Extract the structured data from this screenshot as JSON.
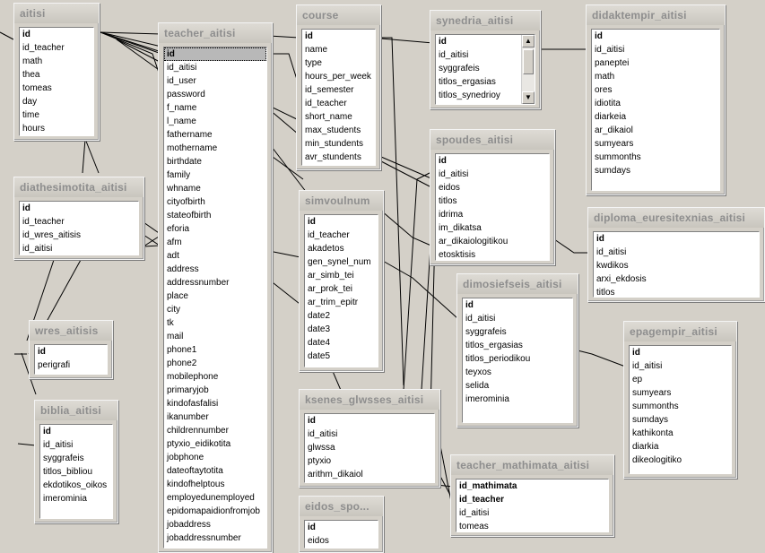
{
  "tables": [
    {
      "name": "aitisi",
      "fields": [
        {
          "label": "id",
          "pk": true
        },
        {
          "label": "id_teacher"
        },
        {
          "label": "math"
        },
        {
          "label": "thea"
        },
        {
          "label": "tomeas"
        },
        {
          "label": "day"
        },
        {
          "label": "time"
        },
        {
          "label": "hours"
        }
      ]
    },
    {
      "name": "teacher_aitisi",
      "fields": [
        {
          "label": "id",
          "pk": true,
          "selected": true
        },
        {
          "label": "id_aitisi"
        },
        {
          "label": "id_user"
        },
        {
          "label": "password"
        },
        {
          "label": "f_name"
        },
        {
          "label": "l_name"
        },
        {
          "label": "fathername"
        },
        {
          "label": "mothername"
        },
        {
          "label": "birthdate"
        },
        {
          "label": "family"
        },
        {
          "label": "whname"
        },
        {
          "label": "cityofbirth"
        },
        {
          "label": "stateofbirth"
        },
        {
          "label": "eforia"
        },
        {
          "label": "afm"
        },
        {
          "label": "adt"
        },
        {
          "label": "address"
        },
        {
          "label": "addressnumber"
        },
        {
          "label": "place"
        },
        {
          "label": "city"
        },
        {
          "label": "tk"
        },
        {
          "label": "mail"
        },
        {
          "label": "phone1"
        },
        {
          "label": "phone2"
        },
        {
          "label": "mobilephone"
        },
        {
          "label": "primaryjob"
        },
        {
          "label": "kindofasfalisi"
        },
        {
          "label": "ikanumber"
        },
        {
          "label": "childrennumber"
        },
        {
          "label": "ptyxio_eidikotita"
        },
        {
          "label": "jobphone"
        },
        {
          "label": "dateoftaytotita"
        },
        {
          "label": "kindofhelptous"
        },
        {
          "label": "employedunemployed"
        },
        {
          "label": "epidomapaidionfromjob"
        },
        {
          "label": "jobaddress"
        },
        {
          "label": "jobaddressnumber"
        }
      ]
    },
    {
      "name": "course",
      "fields": [
        {
          "label": "id",
          "pk": true
        },
        {
          "label": "name"
        },
        {
          "label": "type"
        },
        {
          "label": "hours_per_week"
        },
        {
          "label": "id_semester"
        },
        {
          "label": "id_teacher"
        },
        {
          "label": "short_name"
        },
        {
          "label": "max_students"
        },
        {
          "label": "min_stundents"
        },
        {
          "label": "avr_stundents"
        }
      ]
    },
    {
      "name": "synedria_aitisi",
      "fields": [
        {
          "label": "id",
          "pk": true
        },
        {
          "label": "id_aitisi"
        },
        {
          "label": "syggrafeis"
        },
        {
          "label": "titlos_ergasias"
        },
        {
          "label": "titlos_synedrioy"
        }
      ]
    },
    {
      "name": "didaktempir_aitisi",
      "fields": [
        {
          "label": "id",
          "pk": true
        },
        {
          "label": "id_aitisi"
        },
        {
          "label": "paneptei"
        },
        {
          "label": "math"
        },
        {
          "label": "ores"
        },
        {
          "label": "idiotita"
        },
        {
          "label": "diarkeia"
        },
        {
          "label": "ar_dikaiol"
        },
        {
          "label": "sumyears"
        },
        {
          "label": "summonths"
        },
        {
          "label": "sumdays"
        }
      ]
    },
    {
      "name": "diathesimotita_aitisi",
      "fields": [
        {
          "label": "id",
          "pk": true
        },
        {
          "label": "id_teacher"
        },
        {
          "label": "id_wres_aitisis"
        },
        {
          "label": "id_aitisi"
        }
      ]
    },
    {
      "name": "spoudes_aitisi",
      "fields": [
        {
          "label": "id",
          "pk": true
        },
        {
          "label": "id_aitisi"
        },
        {
          "label": "eidos"
        },
        {
          "label": "titlos"
        },
        {
          "label": "idrima"
        },
        {
          "label": "im_dikatsa"
        },
        {
          "label": "ar_dikaiologitikou"
        },
        {
          "label": "etosktisis"
        }
      ]
    },
    {
      "name": "simvoulnum",
      "fields": [
        {
          "label": "id",
          "pk": true
        },
        {
          "label": "id_teacher"
        },
        {
          "label": "akadetos"
        },
        {
          "label": "gen_synel_num"
        },
        {
          "label": "ar_simb_tei"
        },
        {
          "label": "ar_prok_tei"
        },
        {
          "label": "ar_trim_epitr"
        },
        {
          "label": "date2"
        },
        {
          "label": "date3"
        },
        {
          "label": "date4"
        },
        {
          "label": "date5"
        }
      ]
    },
    {
      "name": "diploma_euresitexnias_aitisi",
      "fields": [
        {
          "label": "id",
          "pk": true
        },
        {
          "label": "id_aitisi"
        },
        {
          "label": "kwdikos"
        },
        {
          "label": "arxi_ekdosis"
        },
        {
          "label": "titlos"
        }
      ]
    },
    {
      "name": "dimosiefseis_aitisi",
      "fields": [
        {
          "label": "id",
          "pk": true
        },
        {
          "label": "id_aitisi"
        },
        {
          "label": "syggrafeis"
        },
        {
          "label": "titlos_ergasias"
        },
        {
          "label": "titlos_periodikou"
        },
        {
          "label": "teyxos"
        },
        {
          "label": "selida"
        },
        {
          "label": "imerominia"
        }
      ]
    },
    {
      "name": "wres_aitisis",
      "fields": [
        {
          "label": "id",
          "pk": true
        },
        {
          "label": "perigrafi"
        }
      ]
    },
    {
      "name": "epagempir_aitisi",
      "fields": [
        {
          "label": "id",
          "pk": true
        },
        {
          "label": "id_aitisi"
        },
        {
          "label": "ep"
        },
        {
          "label": "sumyears"
        },
        {
          "label": "summonths"
        },
        {
          "label": "sumdays"
        },
        {
          "label": "kathikonta"
        },
        {
          "label": "diarkia"
        },
        {
          "label": "dikeologitiko"
        }
      ]
    },
    {
      "name": "biblia_aitisi",
      "fields": [
        {
          "label": "id",
          "pk": true
        },
        {
          "label": "id_aitisi"
        },
        {
          "label": "syggrafeis"
        },
        {
          "label": "titlos_bibliou"
        },
        {
          "label": "ekdotikos_oikos"
        },
        {
          "label": "imerominia"
        }
      ]
    },
    {
      "name": "ksenes_glwsses_aitisi",
      "fields": [
        {
          "label": "id",
          "pk": true
        },
        {
          "label": "id_aitisi"
        },
        {
          "label": "glwssa"
        },
        {
          "label": "ptyxio"
        },
        {
          "label": "arithm_dikaiol"
        }
      ]
    },
    {
      "name": "teacher_mathimata_aitisi",
      "fields": [
        {
          "label": "id_mathimata",
          "pk": true
        },
        {
          "label": "id_teacher",
          "pk": true
        },
        {
          "label": "id_aitisi"
        },
        {
          "label": "tomeas"
        }
      ]
    },
    {
      "name": "eidos_spo...",
      "fields": [
        {
          "label": "id",
          "pk": true
        },
        {
          "label": "eidos"
        }
      ]
    }
  ]
}
